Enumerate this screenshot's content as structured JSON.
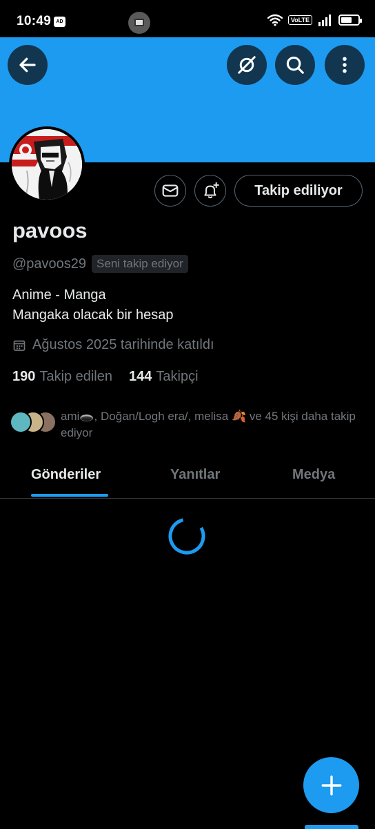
{
  "status_bar": {
    "time": "10:49",
    "ad_badge": "AD",
    "volte": "VoLTE",
    "icons": [
      "wifi-icon",
      "signal-icon",
      "battery-icon"
    ]
  },
  "colors": {
    "banner": "#1d9bf0",
    "accent": "#1d9bf0",
    "background": "#000000",
    "text_primary": "#e7e9ea",
    "text_secondary": "#71767b"
  },
  "header": {
    "icons": [
      "back-arrow-icon",
      "grok-icon",
      "search-icon",
      "more-vertical-icon"
    ]
  },
  "profile": {
    "display_name": "pavoos",
    "handle": "@pavoos29",
    "follows_you_label": "Seni takip ediyor",
    "bio_line1": "Anime - Manga",
    "bio_line2": "Mangaka olacak bir hesap",
    "joined": "Ağustos 2025 tarihinde katıldı",
    "following_count": "190",
    "following_label": "Takip edilen",
    "followers_count": "144",
    "followers_label": "Takipçi",
    "follow_button_label": "Takip ediliyor",
    "action_icons": [
      "message-icon",
      "notification-bell-plus-icon"
    ]
  },
  "mutuals": {
    "text": "ami🕳️, Doğan/Logh era/, melisa 🍂 ve 45 kişi daha takip ediyor"
  },
  "tabs": [
    {
      "label": "Gönderiler",
      "active": true
    },
    {
      "label": "Yanıtlar",
      "active": false
    },
    {
      "label": "Medya",
      "active": false
    }
  ],
  "fab": {
    "icon": "plus-icon"
  }
}
